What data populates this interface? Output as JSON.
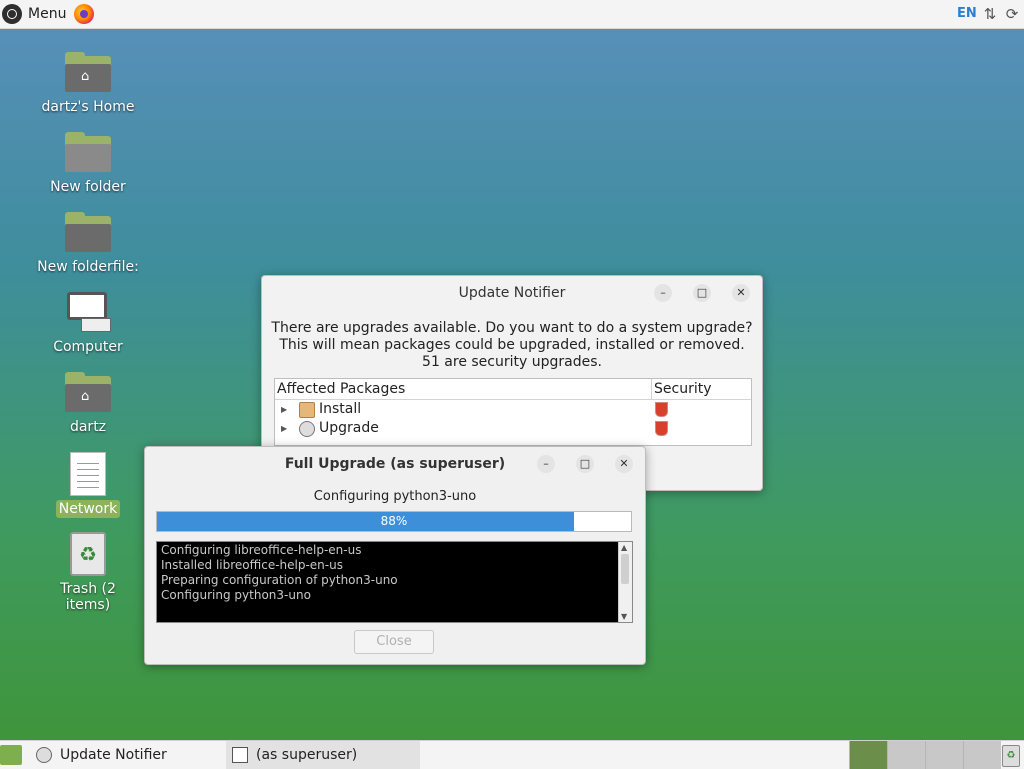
{
  "top_panel": {
    "menu_label": "Menu",
    "language": "EN",
    "browser_icon": "firefox-icon",
    "tray_icons": [
      "network-icon",
      "update-icon"
    ]
  },
  "desktop": {
    "icons": [
      {
        "label": "dartz's Home",
        "icon": "home-folder-icon"
      },
      {
        "label": "New folder",
        "icon": "folder-icon"
      },
      {
        "label": "New folderfile:",
        "icon": "folder-icon"
      },
      {
        "label": "Computer",
        "icon": "computer-icon"
      },
      {
        "label": "dartz",
        "icon": "home-folder-icon"
      },
      {
        "label": "Network",
        "icon": "document-icon"
      },
      {
        "label": "Trash (2 items)",
        "icon": "trash-icon"
      }
    ],
    "selected_icon": "Network"
  },
  "update_notifier": {
    "title": "Update Notifier",
    "message_line1": "There are upgrades available. Do you want to do a system upgrade?",
    "message_line2": "This will mean packages could be upgraded, installed or removed.",
    "message_line3": "51 are security upgrades.",
    "columns": [
      "Affected Packages",
      "Security"
    ],
    "rows": [
      {
        "label": "Install",
        "icon": "package-icon",
        "security_icon": "shield-icon"
      },
      {
        "label": "Upgrade",
        "icon": "upgrade-icon",
        "security_icon": "shield-icon"
      }
    ]
  },
  "full_upgrade": {
    "title": "Full Upgrade (as superuser)",
    "status": "Configuring python3-uno",
    "progress_percent": 88,
    "progress_label": "88%",
    "log_lines": [
      "Configuring libreoffice-help-en-us",
      "Installed libreoffice-help-en-us",
      "Preparing configuration of python3-uno",
      "Configuring python3-uno"
    ],
    "close_label": "Close",
    "close_enabled": false
  },
  "taskbar": {
    "tasks": [
      {
        "label": "Update Notifier",
        "icon": "update-notifier-icon"
      },
      {
        "label": "(as superuser)",
        "icon": "window-icon"
      }
    ],
    "workspaces": 4,
    "active_workspace": 1
  },
  "colors": {
    "accent": "#3d8fd9",
    "selection": "#8ab35a",
    "language": "#2a7fd1"
  }
}
